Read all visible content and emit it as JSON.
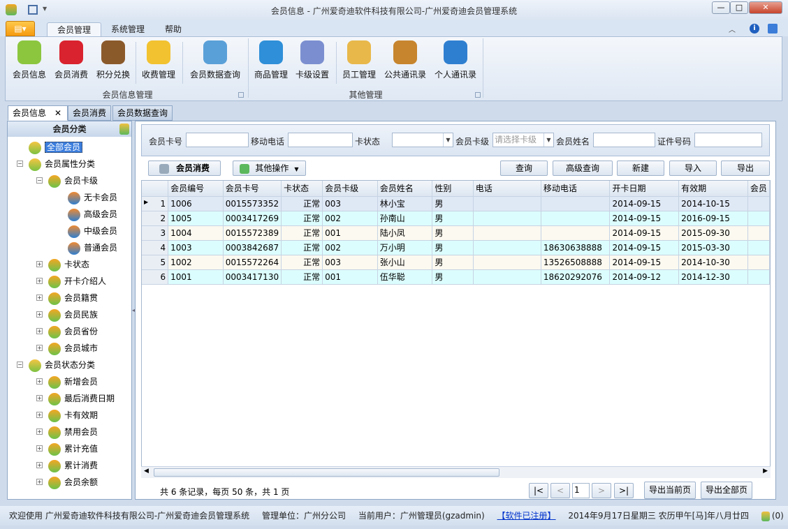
{
  "window": {
    "title": "会员信息 - 广州爱奇迪软件科技有限公司-广州爱奇迪会员管理系统",
    "controls": [
      "—",
      "□",
      "✕"
    ]
  },
  "ribbon_tabs": [
    "会员管理",
    "系统管理",
    "帮助"
  ],
  "ribbon": {
    "groups": [
      {
        "label": "会员信息管理",
        "buttons": [
          {
            "label": "会员信息",
            "icon": "users-icon",
            "color": "#8cc63f"
          },
          {
            "label": "会员消费",
            "icon": "basket-icon",
            "color": "#d9232e"
          },
          {
            "label": "积分兑换",
            "icon": "teddy-bear-icon",
            "color": "#8b5a2b"
          },
          {
            "label": "收费管理",
            "icon": "coins-add-icon",
            "color": "#f2c230"
          },
          {
            "label": "会员数据查询",
            "icon": "document-search-icon",
            "color": "#5aa0d8"
          }
        ]
      },
      {
        "label": "其他管理",
        "buttons": [
          {
            "label": "商品管理",
            "icon": "shapes-icon",
            "color": "#2f8fd8"
          },
          {
            "label": "卡级设置",
            "icon": "id-card-icon",
            "color": "#7b8fd0"
          },
          {
            "label": "员工管理",
            "icon": "employee-badge-icon",
            "color": "#e8b84a"
          },
          {
            "label": "公共通讯录",
            "icon": "address-book-icon",
            "color": "#c7852e"
          },
          {
            "label": "个人通讯录",
            "icon": "notebook-key-icon",
            "color": "#2f7fd0"
          }
        ]
      }
    ]
  },
  "doc_tabs": [
    "会员信息",
    "会员消费",
    "会员数据查询"
  ],
  "left_panel": {
    "title": "会员分类",
    "tree": [
      {
        "label": "全部会员",
        "level": 0,
        "selected": true
      },
      {
        "label": "会员属性分类",
        "level": 0,
        "expanded": true
      },
      {
        "label": "会员卡级",
        "level": 1,
        "expanded": true
      },
      {
        "label": "无卡会员",
        "level": 2
      },
      {
        "label": "高级会员",
        "level": 2
      },
      {
        "label": "中级会员",
        "level": 2
      },
      {
        "label": "普通会员",
        "level": 2
      },
      {
        "label": "卡状态",
        "level": 1
      },
      {
        "label": "开卡介绍人",
        "level": 1
      },
      {
        "label": "会员籍贯",
        "level": 1
      },
      {
        "label": "会员民族",
        "level": 1
      },
      {
        "label": "会员省份",
        "level": 1
      },
      {
        "label": "会员城市",
        "level": 1
      },
      {
        "label": "会员状态分类",
        "level": 0,
        "expanded": true
      },
      {
        "label": "新增会员",
        "level": 1
      },
      {
        "label": "最后消费日期",
        "level": 1
      },
      {
        "label": "卡有效期",
        "level": 1
      },
      {
        "label": "禁用会员",
        "level": 1
      },
      {
        "label": "累计充值",
        "level": 1
      },
      {
        "label": "累计消费",
        "level": 1
      },
      {
        "label": "会员余额",
        "level": 1
      }
    ]
  },
  "search": {
    "card_no": "会员卡号",
    "mobile": "移动电话",
    "card_status": "卡状态",
    "card_level": "会员卡级",
    "card_level_placeholder": "请选择卡级",
    "name": "会员姓名",
    "id_no": "证件号码"
  },
  "actions": {
    "consume": "会员消费",
    "other": "其他操作",
    "query": "查询",
    "advanced": "高级查询",
    "new": "新建",
    "import": "导入",
    "export": "导出"
  },
  "grid": {
    "columns": [
      "会员编号",
      "会员卡号",
      "卡状态",
      "会员卡级",
      "会员姓名",
      "性别",
      "电话",
      "移动电话",
      "开卡日期",
      "有效期",
      "会员"
    ],
    "rows": [
      [
        "1",
        "1006",
        "0015573352",
        "正常",
        "003",
        "林小宝",
        "男",
        "",
        "",
        "2014-09-15",
        "2014-10-15",
        ""
      ],
      [
        "2",
        "1005",
        "0003417269",
        "正常",
        "002",
        "孙南山",
        "男",
        "",
        "",
        "2014-09-15",
        "2016-09-15",
        ""
      ],
      [
        "3",
        "1004",
        "0015572389",
        "正常",
        "001",
        "陆小凤",
        "男",
        "",
        "",
        "2014-09-15",
        "2015-09-30",
        ""
      ],
      [
        "4",
        "1003",
        "0003842687",
        "正常",
        "002",
        "万小明",
        "男",
        "",
        "18630638888",
        "2014-09-15",
        "2015-03-30",
        ""
      ],
      [
        "5",
        "1002",
        "0015572264",
        "正常",
        "003",
        "张小山",
        "男",
        "",
        "13526508888",
        "2014-09-15",
        "2014-10-30",
        ""
      ],
      [
        "6",
        "1001",
        "0003417130",
        "正常",
        "001",
        "伍华聪",
        "男",
        "",
        "18620292076",
        "2014-09-12",
        "2014-12-30",
        ""
      ]
    ],
    "selected_row": 1
  },
  "pager": {
    "summary": "共 6 条记录，每页 50 条，共 1 页",
    "first": "|<",
    "prev": "<",
    "page": "1",
    "next": ">",
    "last": ">|",
    "export_page": "导出当前页",
    "export_all": "导出全部页"
  },
  "status": {
    "welcome": "欢迎使用 广州爱奇迪软件科技有限公司-广州爱奇迪会员管理系统",
    "unit": "管理单位：广州分公司",
    "user": "当前用户：广州管理员(gzadmin)",
    "registered": "【软件已注册】",
    "date": "2014年9月17日星期三 农历甲午[马]年八月廿四",
    "online": "(0)"
  }
}
